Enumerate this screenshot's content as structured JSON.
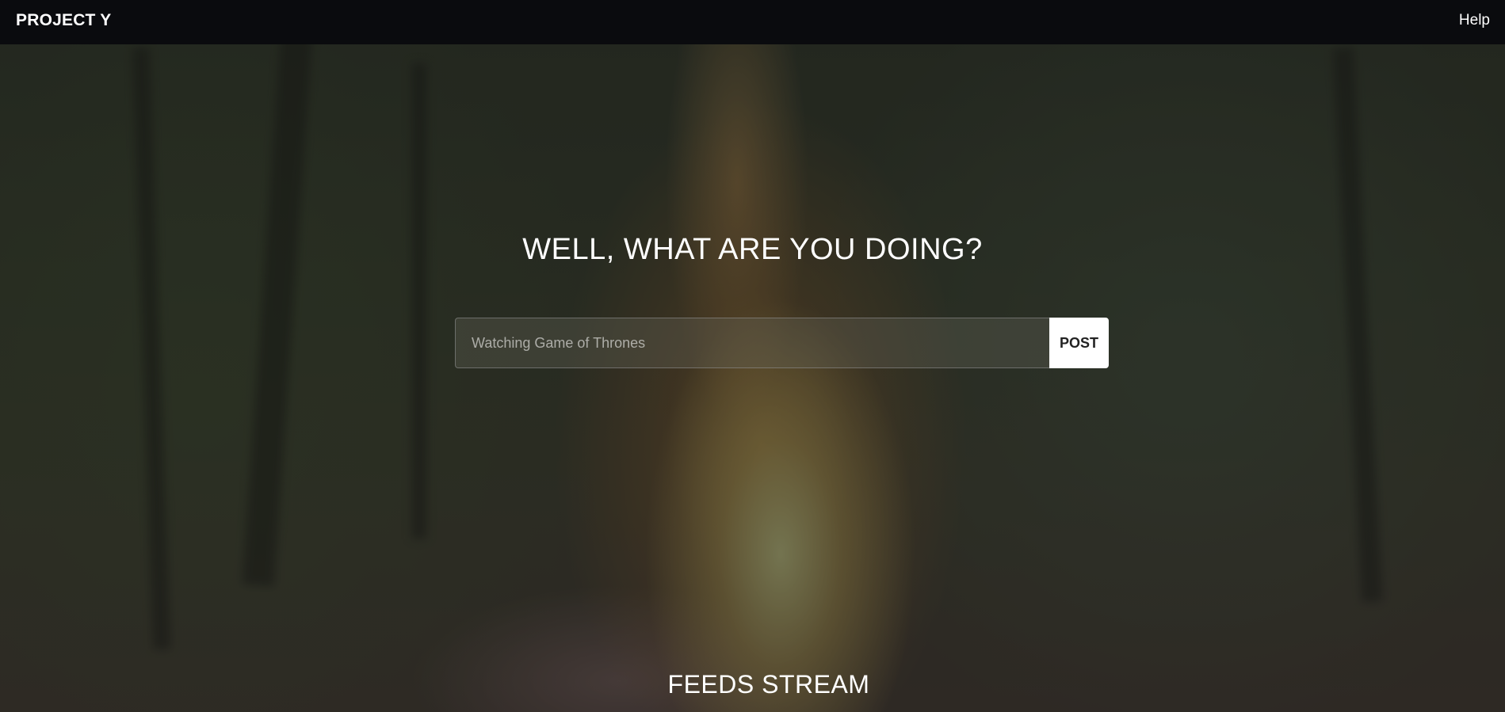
{
  "navbar": {
    "brand": "PROJECT Y",
    "help_label": "Help"
  },
  "hero": {
    "title": "WELL, WHAT ARE YOU DOING?"
  },
  "post_form": {
    "placeholder": "Watching Game of Thrones",
    "value": "",
    "button_label": "POST"
  },
  "feeds": {
    "title": "FEEDS STREAM"
  },
  "colors": {
    "navbar_bg": "#0a0b0e",
    "text": "#ffffff",
    "button_bg": "#ffffff",
    "button_text": "#222222"
  }
}
